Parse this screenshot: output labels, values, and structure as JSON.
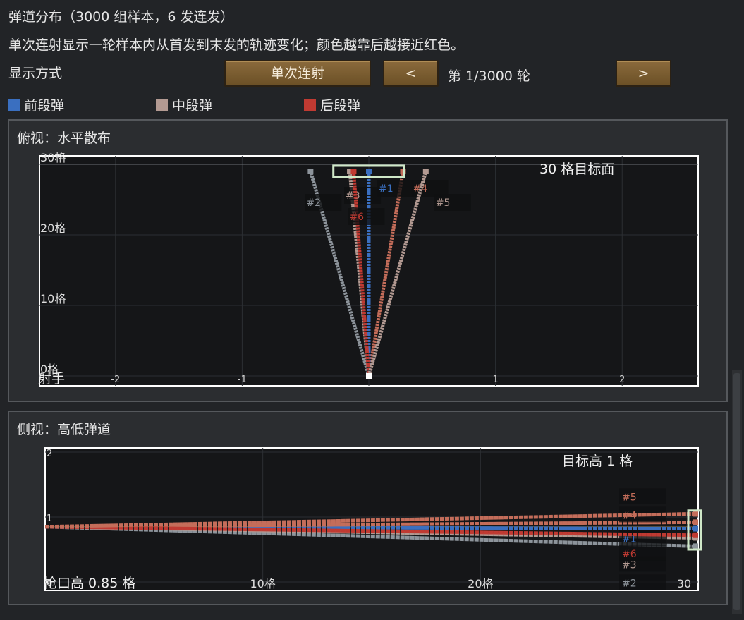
{
  "header": {
    "title": "弹道分布（3000 组样本，6 发连发）",
    "description": "单次连射显示一轮样本内从首发到末发的轨迹变化；颜色越靠后越接近红色。",
    "mode_label": "显示方式",
    "mode_button": "单次连射",
    "prev_button": "<",
    "next_button": ">",
    "round_counter": "第 1/3000 轮"
  },
  "legend": [
    {
      "label": "前段弹",
      "color": "#3a6fc0"
    },
    {
      "label": "中段弹",
      "color": "#b39a92"
    },
    {
      "label": "后段弹",
      "color": "#c03a32"
    }
  ],
  "top_view": {
    "title": "俯视：水平散布",
    "target_label": "30 格目标面",
    "shooter_label": "射手",
    "y_ticks": [
      {
        "label": "30格",
        "value": 30
      },
      {
        "label": "20格",
        "value": 20
      },
      {
        "label": "10格",
        "value": 10
      },
      {
        "label": "0格",
        "value": 0
      }
    ],
    "x_ticks": [
      {
        "label": "-2",
        "value": -2
      },
      {
        "label": "-1",
        "value": -1
      },
      {
        "label": "1",
        "value": 1
      },
      {
        "label": "2",
        "value": 2
      }
    ]
  },
  "side_view": {
    "title": "侧视：高低弹道",
    "target_label": "目标高 1 格",
    "muzzle_label": "枪口高 0.85 格",
    "y_ticks": [
      {
        "label": "2",
        "value": 2
      },
      {
        "label": "1",
        "value": 1
      },
      {
        "label": "0",
        "value": 0
      }
    ],
    "x_ticks": [
      {
        "label": "10格",
        "value": 10
      },
      {
        "label": "20格",
        "value": 20
      },
      {
        "label": "30",
        "value": 30
      }
    ]
  },
  "chart_data": [
    {
      "type": "line",
      "title": "俯视：水平散布",
      "xlim": [
        -2.6,
        2.6
      ],
      "ylim": [
        0,
        30
      ],
      "series": [
        {
          "name": "#1",
          "color": "#3a6fc0",
          "x": [
            0,
            0.0
          ],
          "y": [
            0,
            29
          ]
        },
        {
          "name": "#2",
          "color": "#8d949b",
          "x": [
            0,
            -0.46
          ],
          "y": [
            0,
            29
          ]
        },
        {
          "name": "#3",
          "color": "#b39a92",
          "x": [
            0,
            -0.15
          ],
          "y": [
            0,
            29
          ]
        },
        {
          "name": "#4",
          "color": "#c46d5a",
          "x": [
            0,
            0.27
          ],
          "y": [
            0,
            29
          ]
        },
        {
          "name": "#5",
          "color": "#b39a92",
          "x": [
            0,
            0.45
          ],
          "y": [
            0,
            29
          ]
        },
        {
          "name": "#6",
          "color": "#c03a32",
          "x": [
            0,
            -0.12
          ],
          "y": [
            0,
            29
          ]
        }
      ]
    },
    {
      "type": "line",
      "title": "侧视：高低弹道",
      "xlim": [
        0,
        30
      ],
      "ylim": [
        0,
        2
      ],
      "series": [
        {
          "name": "#1",
          "color": "#3a6fc0",
          "x": [
            0,
            30
          ],
          "y": [
            0.85,
            0.82
          ]
        },
        {
          "name": "#2",
          "color": "#8d949b",
          "x": [
            0,
            30
          ],
          "y": [
            0.85,
            0.55
          ]
        },
        {
          "name": "#3",
          "color": "#b39a92",
          "x": [
            0,
            30
          ],
          "y": [
            0.85,
            0.68
          ]
        },
        {
          "name": "#4",
          "color": "#c46d5a",
          "x": [
            0,
            30
          ],
          "y": [
            0.85,
            0.92
          ]
        },
        {
          "name": "#5",
          "color": "#c46d5a",
          "x": [
            0,
            30
          ],
          "y": [
            0.85,
            1.05
          ]
        },
        {
          "name": "#6",
          "color": "#c03a32",
          "x": [
            0,
            30
          ],
          "y": [
            0.85,
            0.72
          ]
        }
      ]
    }
  ]
}
